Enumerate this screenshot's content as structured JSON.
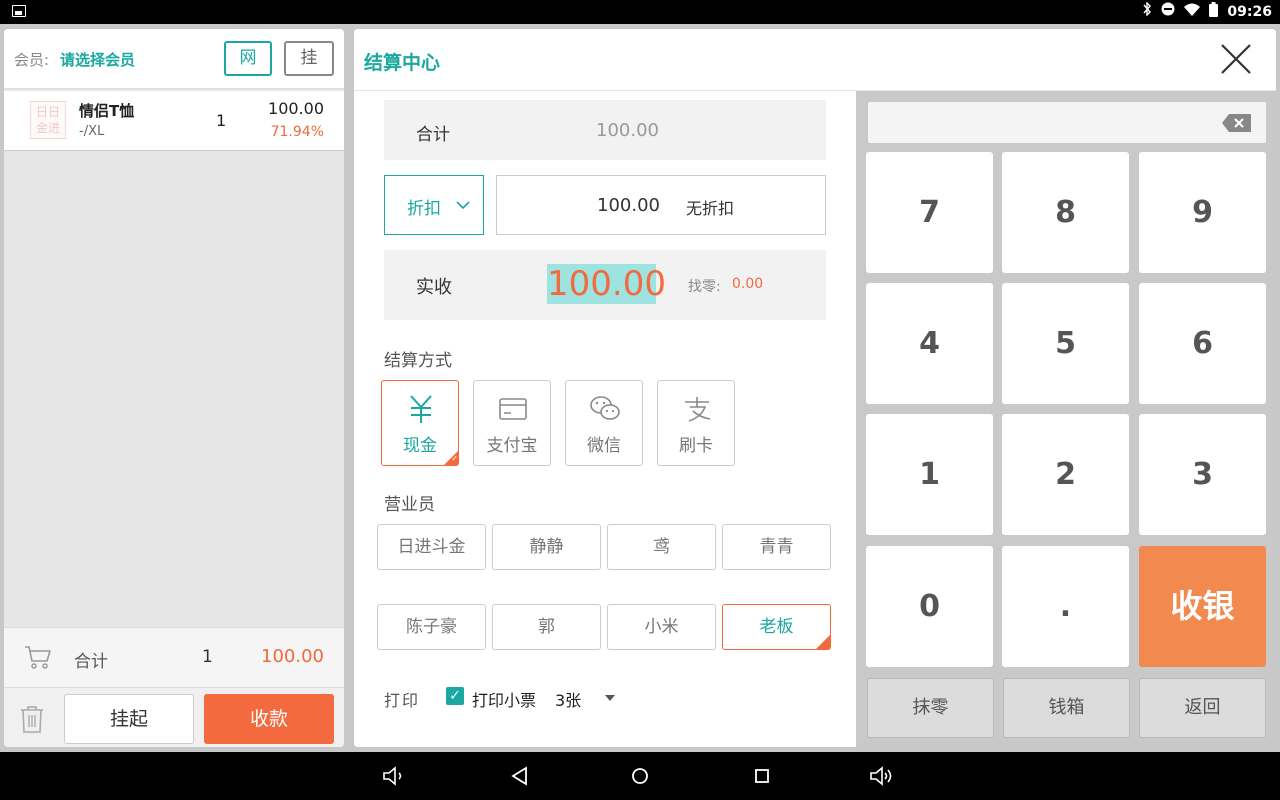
{
  "status_bar": {
    "time": "09:26"
  },
  "left_panel": {
    "member_label": "会员:",
    "member_value": "请选择会员",
    "btn_net": "网",
    "btn_hang": "挂",
    "items": [
      {
        "thumb_text": "日日金进",
        "name": "情侣T恤",
        "spec": "-/XL",
        "qty": "1",
        "price": "100.00",
        "discount_pct": "71.94%"
      }
    ],
    "summary": {
      "label": "合计",
      "qty": "1",
      "amount": "100.00"
    },
    "btn_suspend": "挂起",
    "btn_collect": "收款"
  },
  "settle": {
    "title": "结算中心",
    "total_label": "合计",
    "total_value": "100.00",
    "discount_btn": "折扣",
    "discount_value": "100.00",
    "discount_note": "无折扣",
    "received_label": "实收",
    "received_value": "100.00",
    "change_label": "找零:",
    "change_value": "0.00",
    "pay_method_label": "结算方式",
    "pay_methods": [
      {
        "label": "现金",
        "icon": "yen-icon",
        "active": true
      },
      {
        "label": "支付宝",
        "icon": "card-icon",
        "active": false
      },
      {
        "label": "微信",
        "icon": "wechat-icon",
        "active": false
      },
      {
        "label": "刷卡",
        "icon": "alipay-icon",
        "active": false
      }
    ],
    "staff_label": "营业员",
    "staff": [
      "日进斗金",
      "静静",
      "鸢",
      "青青",
      "陈子豪",
      "郭",
      "小米",
      "老板"
    ],
    "staff_selected": "老板",
    "print_label": "打印",
    "print_ticket_label": "打印小票",
    "print_checked": true,
    "print_count": "3张"
  },
  "keypad": {
    "display": "",
    "keys": [
      "7",
      "8",
      "9",
      "4",
      "5",
      "6",
      "1",
      "2",
      "3",
      "0",
      "."
    ],
    "checkout": "收银",
    "functions": [
      "抹零",
      "钱箱",
      "返回"
    ]
  },
  "colors": {
    "teal": "#1aa8a0",
    "orange": "#f26a3e"
  }
}
